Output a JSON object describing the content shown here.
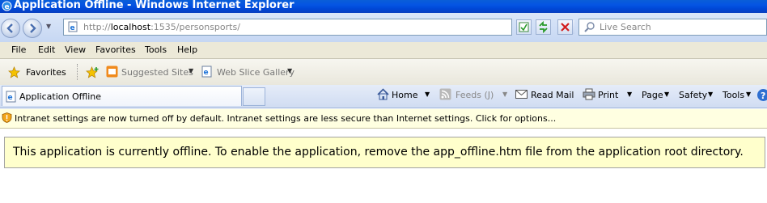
{
  "window": {
    "title": "Application Offline - Windows Internet Explorer"
  },
  "address_bar": {
    "url_prefix": "http://",
    "url_host": "localhost",
    "url_rest": ":1535/personsports/",
    "search_placeholder": "Live Search"
  },
  "menu": {
    "items": [
      "File",
      "Edit",
      "View",
      "Favorites",
      "Tools",
      "Help"
    ]
  },
  "favorites_bar": {
    "favorites_label": "Favorites",
    "suggested_sites": "Suggested Sites",
    "web_slice_gallery": "Web Slice Gallery"
  },
  "tab": {
    "title": "Application Offline"
  },
  "command_bar": {
    "home": "Home",
    "feeds": "Feeds (J)",
    "read_mail": "Read Mail",
    "print": "Print",
    "page": "Page",
    "safety": "Safety",
    "tools": "Tools"
  },
  "info_bar": {
    "text": "Intranet settings are now turned off by default. Intranet settings are less secure than Internet settings. Click for options..."
  },
  "content": {
    "message": "This application is currently offline. To enable the application, remove the app_offline.htm file from the application root directory."
  },
  "colors": {
    "titlebar": "#0454e3",
    "infobar": "#ffffe1",
    "offline_box": "#ffffcc"
  }
}
